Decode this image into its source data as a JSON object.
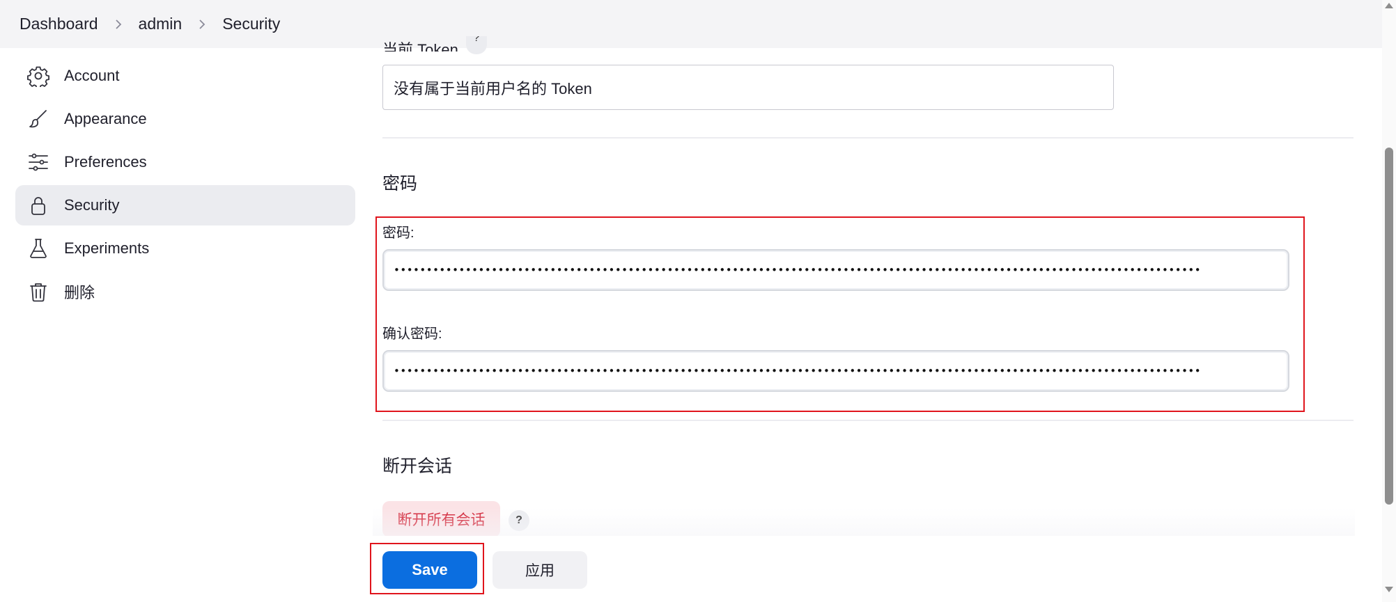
{
  "breadcrumb": {
    "items": [
      "Dashboard",
      "admin",
      "Security"
    ]
  },
  "sidebar": {
    "items": [
      {
        "label": "Account",
        "icon": "gear-icon"
      },
      {
        "label": "Appearance",
        "icon": "paintbrush-icon"
      },
      {
        "label": "Preferences",
        "icon": "sliders-icon"
      },
      {
        "label": "Security",
        "icon": "lock-icon",
        "active": true
      },
      {
        "label": "Experiments",
        "icon": "flask-icon"
      },
      {
        "label": "删除",
        "icon": "trash-icon"
      }
    ]
  },
  "token": {
    "label": "当前 Token",
    "help": "?",
    "value": "没有属于当前用户名的 Token"
  },
  "password_section": {
    "title": "密码",
    "password_label": "密码:",
    "password_value": "••••••••••••••••••••••••••••••••••••••••••••••••••••••••••••••••••••••••••••••••••••••••••••••••••••••••••••••••••••••••••••",
    "confirm_label": "确认密码:",
    "confirm_value": "••••••••••••••••••••••••••••••••••••••••••••••••••••••••••••••••••••••••••••••••••••••••••••••••••••••••••••••••••••••••••••"
  },
  "sessions_section": {
    "title": "断开会话",
    "button_label": "断开所有会话",
    "help": "?"
  },
  "actions": {
    "save_label": "Save",
    "apply_label": "应用"
  },
  "colors": {
    "primary": "#0b6ee0",
    "danger": "#d0182c",
    "highlight_border": "#e0141c",
    "active_nav_bg": "#ebecf0"
  }
}
